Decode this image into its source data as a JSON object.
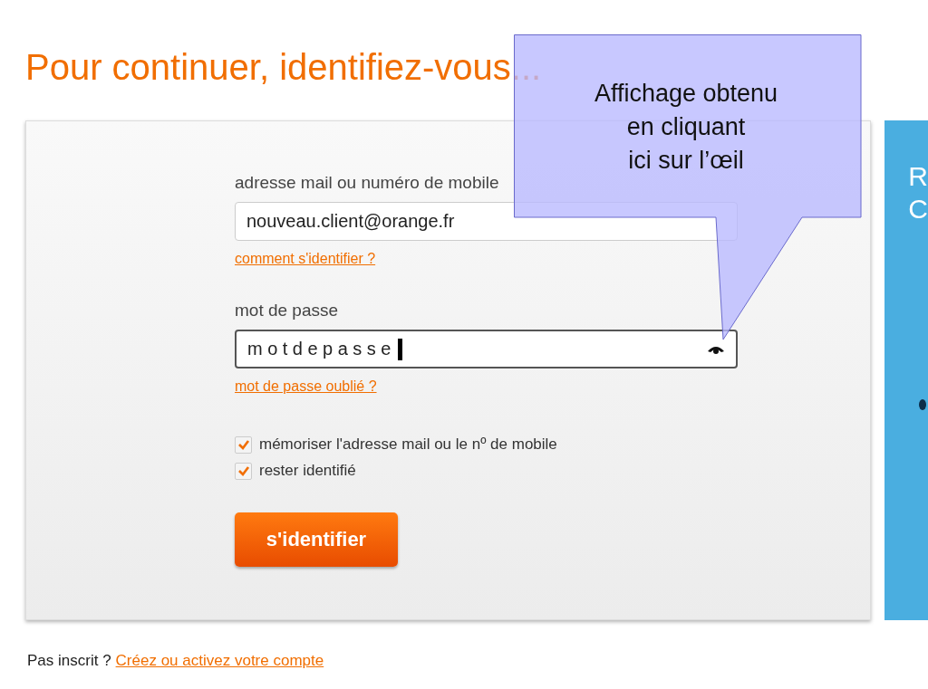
{
  "title": "Pour continuer, identifiez-vous...",
  "login_form": {
    "fields": [
      {
        "label": "adresse mail ou numéro de mobile",
        "value": "nouveau.client@orange.fr",
        "kind": "text",
        "focused": false,
        "help_link": "comment s'identifier ?"
      },
      {
        "label": "mot de passe",
        "value": "motdepasse",
        "kind": "password",
        "focused": true,
        "help_link": "mot de passe oublié ?"
      }
    ],
    "options": [
      {
        "label": "mémoriser l'adresse mail ou le nº de mobile",
        "checked": true
      },
      {
        "label": "rester identifié",
        "checked": true
      }
    ],
    "submit_button": "s'identifier"
  },
  "side_panel": {
    "lines": [
      "R",
      "C"
    ]
  },
  "footer": {
    "text": "Pas inscrit ?",
    "link": "Créez ou activez votre compte"
  },
  "callout": {
    "lines": [
      "Affichage obtenu",
      "en cliquant",
      "ici sur l’œil"
    ]
  }
}
